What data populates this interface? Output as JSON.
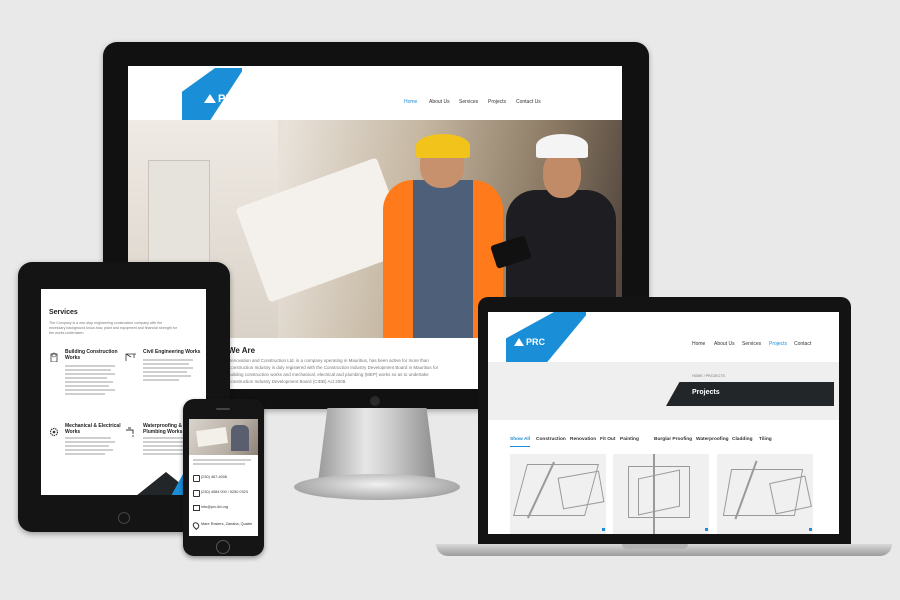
{
  "brand": {
    "name": "PRC",
    "accent": "#1a8fd8",
    "dark": "#222629"
  },
  "desktop": {
    "nav": [
      "Home",
      "About Us",
      "Services",
      "Projects",
      "Contact Us"
    ],
    "active_nav": "Home",
    "about_heading": "We Are",
    "about_lines": [
      "Renovation and Construction Ltd. is a company operating in Mauritius, has been active for more than",
      "Construction Industry is duly registered with the Construction Industry Development Board in Mauritius for",
      "building construction works and mechanical, electrical and plumbing (MEP) works so as to undertake",
      "Construction Industry Development Board (CIDB) Act 2008."
    ]
  },
  "tablet": {
    "services_heading": "Services",
    "intro_lines": [
      "The Company is a one-stop engineering construction company with the",
      "necessary background know-how, plant and equipment and financial strength for",
      "the works undertaken."
    ],
    "services": [
      {
        "title_lines": [
          "Building Construction",
          "Works"
        ],
        "icon": "building-icon"
      },
      {
        "title_lines": [
          "Civil Engineering Works"
        ],
        "icon": "crane-icon"
      },
      {
        "title_lines": [
          "Mechanical & Electrical",
          "Works"
        ],
        "icon": "gear-icon"
      },
      {
        "title_lines": [
          "Waterproofing &",
          "Plumbing Works"
        ],
        "icon": "faucet-icon"
      }
    ]
  },
  "phone": {
    "contact": [
      {
        "icon": "phone-icon",
        "text": "(230) 467-4006"
      },
      {
        "icon": "phone-icon",
        "text": "(230) 4584 000 / 5250 0323"
      },
      {
        "icon": "mail-icon",
        "text": "info@prc-ltd.org"
      },
      {
        "icon": "location-icon",
        "text": "Mare Rosiers, Zanaba, Quatre"
      }
    ]
  },
  "laptop": {
    "nav": [
      "Home",
      "About Us",
      "Services",
      "Projects",
      "Contact"
    ],
    "active_nav": "Projects",
    "breadcrumb": "HOME / PROJECTS",
    "page_title": "Projects",
    "filters": [
      "Show All",
      "Construction",
      "Renovation",
      "Fit Out",
      "Painting",
      "Burglar Proofing",
      "Waterproofing",
      "Cladding",
      "Tiling"
    ],
    "active_filter": "Show All"
  }
}
